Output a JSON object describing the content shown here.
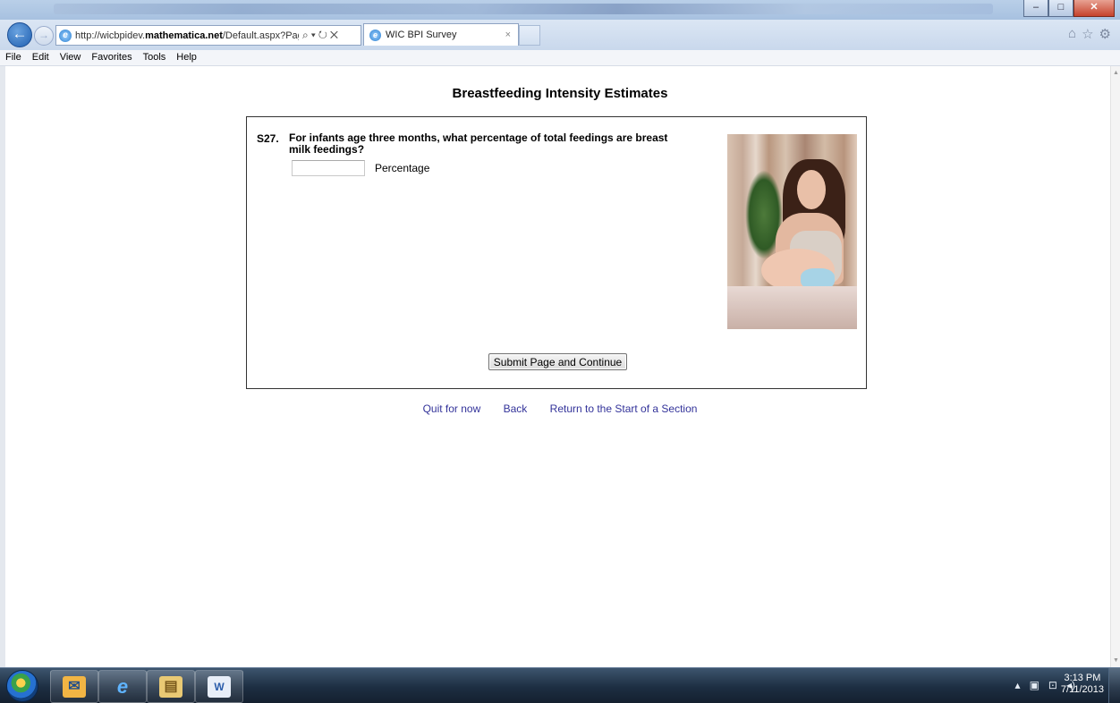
{
  "browser": {
    "address_url_prefix": "http://wicbpidev.",
    "address_url_domain": "mathematica.net",
    "address_url_suffix": "/Default.aspx?Page=",
    "tab_title": "WIC BPI Survey",
    "tab_close": "×"
  },
  "menu": {
    "file": "File",
    "edit": "Edit",
    "view": "View",
    "favorites": "Favorites",
    "tools": "Tools",
    "help": "Help"
  },
  "page": {
    "title": "Breastfeeding Intensity Estimates",
    "question_number": "S27.",
    "question_text": "For infants age three months, what percentage of total feedings are breast milk feedings?",
    "input_value": "",
    "input_label": "Percentage",
    "submit_label": "Submit Page and Continue",
    "links": {
      "quit": "Quit for now",
      "back": "Back",
      "return": "Return to the Start of a Section"
    }
  },
  "taskbar": {
    "time": "3:13 PM",
    "date": "7/11/2013",
    "icons": [
      "outlook-icon",
      "internet-explorer-icon",
      "file-explorer-icon",
      "word-icon"
    ]
  }
}
